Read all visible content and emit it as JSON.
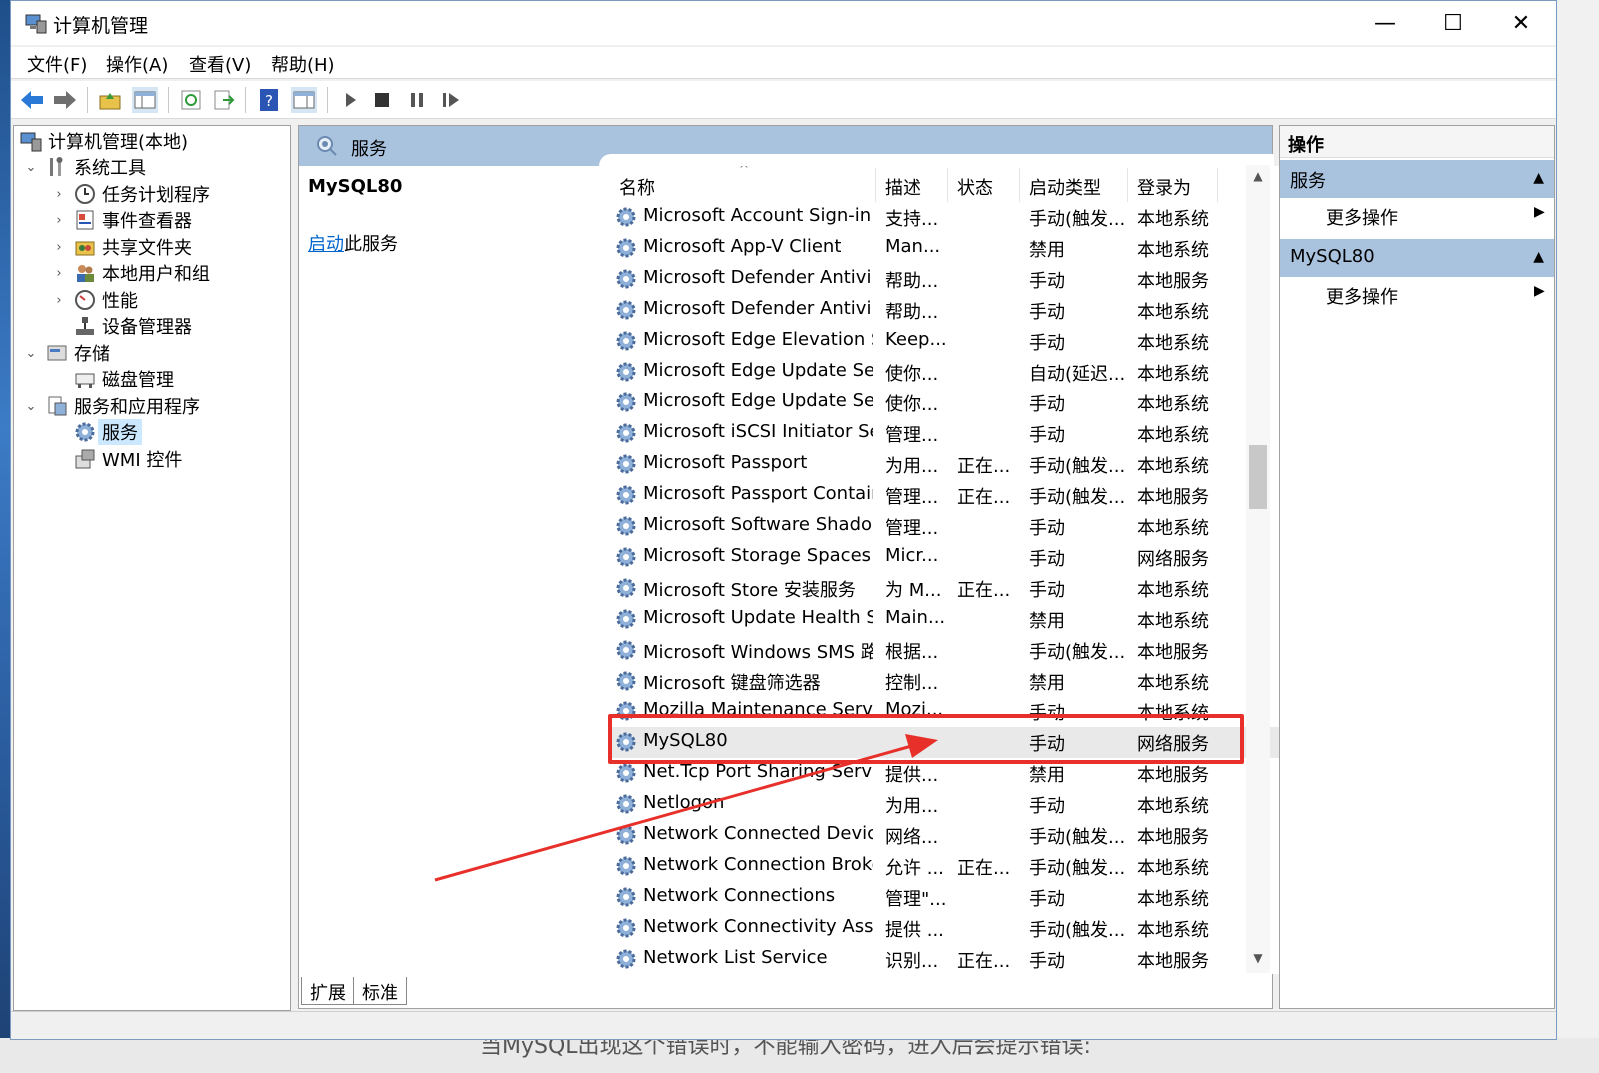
{
  "window": {
    "title": "计算机管理",
    "controls": {
      "minimize": "—",
      "maximize": "☐",
      "close": "✕"
    }
  },
  "menu": [
    "文件(F)",
    "操作(A)",
    "查看(V)",
    "帮助(H)"
  ],
  "tree": {
    "root": "计算机管理(本地)",
    "system_tools": "系统工具",
    "task_scheduler": "任务计划程序",
    "event_viewer": "事件查看器",
    "shared_folders": "共享文件夹",
    "local_users": "本地用户和组",
    "performance": "性能",
    "device_manager": "设备管理器",
    "storage": "存储",
    "disk_mgmt": "磁盘管理",
    "services_apps": "服务和应用程序",
    "services": "服务",
    "wmi": "WMI 控件"
  },
  "center": {
    "header": "服务",
    "selected_name": "MySQL80",
    "action_link": "启动",
    "action_suffix": "此服务"
  },
  "columns": {
    "name": "名称",
    "desc": "描述",
    "status": "状态",
    "startup": "启动类型",
    "logon": "登录为"
  },
  "services": [
    {
      "name": "Microsoft Account Sign-in ...",
      "desc": "支持...",
      "status": "",
      "startup": "手动(触发...",
      "logon": "本地系统"
    },
    {
      "name": "Microsoft App-V Client",
      "desc": "Man...",
      "status": "",
      "startup": "禁用",
      "logon": "本地系统"
    },
    {
      "name": "Microsoft Defender Antivir...",
      "desc": "帮助...",
      "status": "",
      "startup": "手动",
      "logon": "本地服务"
    },
    {
      "name": "Microsoft Defender Antivir...",
      "desc": "帮助...",
      "status": "",
      "startup": "手动",
      "logon": "本地系统"
    },
    {
      "name": "Microsoft Edge Elevation S...",
      "desc": "Keep...",
      "status": "",
      "startup": "手动",
      "logon": "本地系统"
    },
    {
      "name": "Microsoft Edge Update Ser...",
      "desc": "使你...",
      "status": "",
      "startup": "自动(延迟...",
      "logon": "本地系统"
    },
    {
      "name": "Microsoft Edge Update Ser...",
      "desc": "使你...",
      "status": "",
      "startup": "手动",
      "logon": "本地系统"
    },
    {
      "name": "Microsoft iSCSI Initiator Ser...",
      "desc": "管理...",
      "status": "",
      "startup": "手动",
      "logon": "本地系统"
    },
    {
      "name": "Microsoft Passport",
      "desc": "为用...",
      "status": "正在...",
      "startup": "手动(触发...",
      "logon": "本地系统"
    },
    {
      "name": "Microsoft Passport Container",
      "desc": "管理...",
      "status": "正在...",
      "startup": "手动(触发...",
      "logon": "本地服务"
    },
    {
      "name": "Microsoft Software Shado...",
      "desc": "管理...",
      "status": "",
      "startup": "手动",
      "logon": "本地系统"
    },
    {
      "name": "Microsoft Storage Spaces S...",
      "desc": "Micr...",
      "status": "",
      "startup": "手动",
      "logon": "网络服务"
    },
    {
      "name": "Microsoft Store 安装服务",
      "desc": "为 M...",
      "status": "正在...",
      "startup": "手动",
      "logon": "本地系统"
    },
    {
      "name": "Microsoft Update Health S...",
      "desc": "Main...",
      "status": "",
      "startup": "禁用",
      "logon": "本地系统"
    },
    {
      "name": "Microsoft Windows SMS 路...",
      "desc": "根据...",
      "status": "",
      "startup": "手动(触发...",
      "logon": "本地服务"
    },
    {
      "name": "Microsoft 键盘筛选器",
      "desc": "控制...",
      "status": "",
      "startup": "禁用",
      "logon": "本地系统"
    },
    {
      "name": "Mozilla Maintenance Service",
      "desc": "Mozi...",
      "status": "",
      "startup": "手动",
      "logon": "本地系统"
    },
    {
      "name": "MySQL80",
      "desc": "",
      "status": "",
      "startup": "手动",
      "logon": "网络服务"
    },
    {
      "name": "Net.Tcp Port Sharing Service",
      "desc": "提供...",
      "status": "",
      "startup": "禁用",
      "logon": "本地服务"
    },
    {
      "name": "Netlogon",
      "desc": "为用...",
      "status": "",
      "startup": "手动",
      "logon": "本地系统"
    },
    {
      "name": "Network Connected Devic...",
      "desc": "网络...",
      "status": "",
      "startup": "手动(触发...",
      "logon": "本地服务"
    },
    {
      "name": "Network Connection Broker",
      "desc": "允许 ...",
      "status": "正在...",
      "startup": "手动(触发...",
      "logon": "本地系统"
    },
    {
      "name": "Network Connections",
      "desc": "管理\"...",
      "status": "",
      "startup": "手动",
      "logon": "本地系统"
    },
    {
      "name": "Network Connectivity Assis...",
      "desc": "提供 ...",
      "status": "",
      "startup": "手动(触发...",
      "logon": "本地系统"
    },
    {
      "name": "Network List Service",
      "desc": "识别...",
      "status": "正在...",
      "startup": "手动",
      "logon": "本地服务"
    }
  ],
  "tabs": {
    "extended": "扩展",
    "standard": "标准"
  },
  "actions": {
    "header": "操作",
    "section1": "服务",
    "more1": "更多操作",
    "section2": "MySQL80",
    "more2": "更多操作"
  },
  "background_text": "当MySQL出现这个错误时，不能输入密码，进入后会提示错误:",
  "colors": {
    "accent": "#a9c2de",
    "highlight": "#e8302a",
    "link": "#0066cc"
  }
}
